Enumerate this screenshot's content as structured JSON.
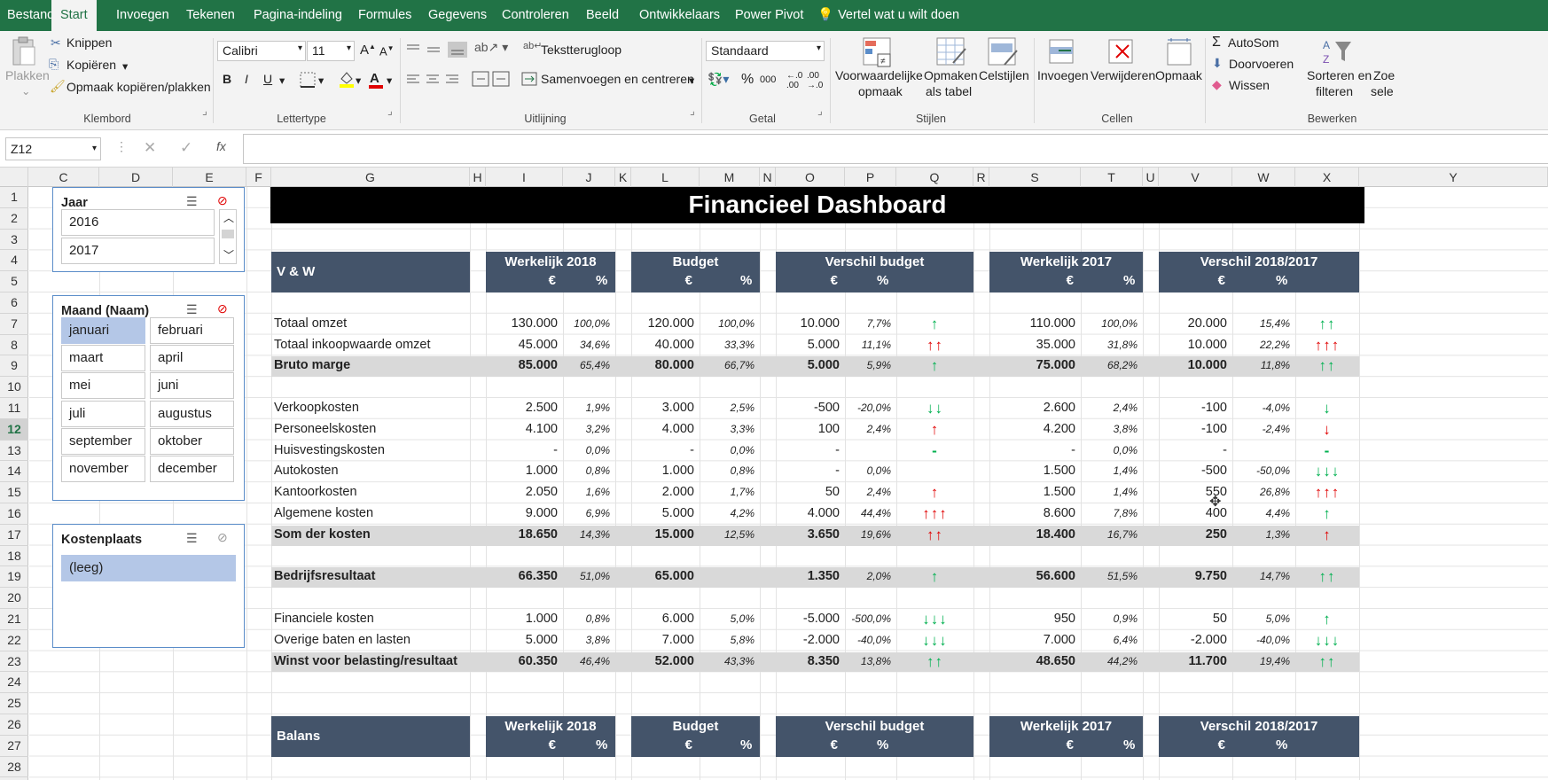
{
  "ribbon_tabs": [
    "Bestand",
    "Start",
    "Invoegen",
    "Tekenen",
    "Pagina-indeling",
    "Formules",
    "Gegevens",
    "Controleren",
    "Beeld",
    "Ontwikkelaars",
    "Power Pivot"
  ],
  "active_tab": "Start",
  "tell_me": "Vertel wat u wilt doen",
  "ribbon": {
    "paste": "Plakken",
    "cut": "Knippen",
    "copy": "Kopiëren",
    "format_painter": "Opmaak kopiëren/plakken",
    "group_clipboard": "Klembord",
    "font_name": "Calibri",
    "font_size": "11",
    "bold": "B",
    "italic": "I",
    "underline": "U",
    "group_font": "Lettertype",
    "wrap_text": "Tekstterugloop",
    "merge_center": "Samenvoegen en centreren",
    "group_alignment": "Uitlijning",
    "number_format": "Standaard",
    "percent": "%",
    "thousands": "000",
    "group_number": "Getal",
    "cond_format": "Voorwaardelijke",
    "cond_format2": "opmaak",
    "format_table": "Opmaken",
    "format_table2": "als tabel",
    "cell_styles": "Celstijlen",
    "group_styles": "Stijlen",
    "insert": "Invoegen",
    "delete": "Verwijderen",
    "format": "Opmaak",
    "group_cells": "Cellen",
    "autosum": "AutoSom",
    "fill": "Doorvoeren",
    "clear": "Wissen",
    "sort_filter": "Sorteren en",
    "sort_filter2": "filteren",
    "find": "Zoe",
    "find2": "sele",
    "group_editing": "Bewerken"
  },
  "name_box": "Z12",
  "fx": "fx",
  "columns": [
    "C",
    "D",
    "E",
    "F",
    "G",
    "H",
    "I",
    "J",
    "K",
    "L",
    "M",
    "N",
    "O",
    "P",
    "Q",
    "R",
    "S",
    "T",
    "U",
    "V",
    "W",
    "X",
    "Y"
  ],
  "rows": [
    "1",
    "2",
    "3",
    "4",
    "5",
    "6",
    "7",
    "8",
    "9",
    "10",
    "11",
    "12",
    "13",
    "14",
    "15",
    "16",
    "17",
    "18",
    "19",
    "20",
    "21",
    "22",
    "23",
    "24",
    "25",
    "26",
    "27",
    "28"
  ],
  "selected_row": "12",
  "slicers": {
    "year": {
      "title": "Jaar",
      "items": [
        "2016",
        "2017"
      ]
    },
    "month": {
      "title": "Maand (Naam)",
      "items": [
        "januari",
        "februari",
        "maart",
        "april",
        "mei",
        "juni",
        "juli",
        "augustus",
        "september",
        "oktober",
        "november",
        "december"
      ],
      "selected": "januari"
    },
    "costcenter": {
      "title": "Kostenplaats",
      "items": [
        "(leeg)"
      ]
    }
  },
  "dashboard": {
    "title": "Financieel Dashboard",
    "section1": "V & W",
    "section2": "Balans",
    "group_headers": [
      "Werkelijk 2018",
      "Budget",
      "Verschil budget",
      "Werkelijk 2017",
      "Verschil 2018/2017"
    ],
    "currency": "€",
    "percent": "%",
    "rows": [
      {
        "label": "Totaal omzet",
        "bold": false,
        "v": [
          "130.000",
          "100,0%",
          "120.000",
          "100,0%",
          "10.000",
          "7,7%",
          "↑",
          "110.000",
          "100,0%",
          "20.000",
          "15,4%",
          "↑↑"
        ],
        "a1": "up",
        "a2": "up"
      },
      {
        "label": "Totaal inkoopwaarde omzet",
        "bold": false,
        "v": [
          "45.000",
          "34,6%",
          "40.000",
          "33,3%",
          "5.000",
          "11,1%",
          "↑↑",
          "35.000",
          "31,8%",
          "10.000",
          "22,2%",
          "↑↑↑"
        ],
        "a1": "rd",
        "a2": "rd"
      },
      {
        "label": "Bruto marge",
        "bold": true,
        "v": [
          "85.000",
          "65,4%",
          "80.000",
          "66,7%",
          "5.000",
          "5,9%",
          "↑",
          "75.000",
          "68,2%",
          "10.000",
          "11,8%",
          "↑↑"
        ],
        "a1": "up",
        "a2": "up"
      },
      null,
      {
        "label": "Verkoopkosten",
        "bold": false,
        "v": [
          "2.500",
          "1,9%",
          "3.000",
          "2,5%",
          "-500",
          "-20,0%",
          "↓↓",
          "2.600",
          "2,4%",
          "-100",
          "-4,0%",
          "↓"
        ],
        "a1": "up",
        "a2": "up"
      },
      {
        "label": "Personeelskosten",
        "bold": false,
        "v": [
          "4.100",
          "3,2%",
          "4.000",
          "3,3%",
          "100",
          "2,4%",
          "↑",
          "4.200",
          "3,8%",
          "-100",
          "-2,4%",
          "↓"
        ],
        "a1": "rd",
        "a2": "rd"
      },
      {
        "label": "Huisvestingskosten",
        "bold": false,
        "v": [
          "-",
          "0,0%",
          "-",
          "0,0%",
          "-",
          "",
          "-",
          "-",
          "0,0%",
          "-",
          "",
          "-"
        ],
        "a1": "up",
        "a2": "up"
      },
      {
        "label": "Autokosten",
        "bold": false,
        "v": [
          "1.000",
          "0,8%",
          "1.000",
          "0,8%",
          "-",
          "0,0%",
          "",
          "1.500",
          "1,4%",
          "-500",
          "-50,0%",
          "↓↓↓"
        ],
        "a1": "up",
        "a2": "up"
      },
      {
        "label": "Kantoorkosten",
        "bold": false,
        "v": [
          "2.050",
          "1,6%",
          "2.000",
          "1,7%",
          "50",
          "2,4%",
          "↑",
          "1.500",
          "1,4%",
          "550",
          "26,8%",
          "↑↑↑"
        ],
        "a1": "rd",
        "a2": "rd"
      },
      {
        "label": "Algemene kosten",
        "bold": false,
        "v": [
          "9.000",
          "6,9%",
          "5.000",
          "4,2%",
          "4.000",
          "44,4%",
          "↑↑↑",
          "8.600",
          "7,8%",
          "400",
          "4,4%",
          "↑"
        ],
        "a1": "rd",
        "a2": "up"
      },
      {
        "label": "Som der kosten",
        "bold": true,
        "v": [
          "18.650",
          "14,3%",
          "15.000",
          "12,5%",
          "3.650",
          "19,6%",
          "↑↑",
          "18.400",
          "16,7%",
          "250",
          "1,3%",
          "↑"
        ],
        "a1": "rd",
        "a2": "rd"
      },
      null,
      {
        "label": "Bedrijfsresultaat",
        "bold": true,
        "v": [
          "66.350",
          "51,0%",
          "65.000",
          "",
          "1.350",
          "2,0%",
          "↑",
          "56.600",
          "51,5%",
          "9.750",
          "14,7%",
          "↑↑"
        ],
        "a1": "up",
        "a2": "up"
      },
      null,
      {
        "label": "Financiele kosten",
        "bold": false,
        "v": [
          "1.000",
          "0,8%",
          "6.000",
          "5,0%",
          "-5.000",
          "-500,0%",
          "↓↓↓",
          "950",
          "0,9%",
          "50",
          "5,0%",
          "↑"
        ],
        "a1": "up",
        "a2": "up"
      },
      {
        "label": "Overige baten en lasten",
        "bold": false,
        "v": [
          "5.000",
          "3,8%",
          "7.000",
          "5,8%",
          "-2.000",
          "-40,0%",
          "↓↓↓",
          "7.000",
          "6,4%",
          "-2.000",
          "-40,0%",
          "↓↓↓"
        ],
        "a1": "up",
        "a2": "up"
      },
      {
        "label": "Winst voor belasting/resultaat",
        "bold": true,
        "v": [
          "60.350",
          "46,4%",
          "52.000",
          "43,3%",
          "8.350",
          "13,8%",
          "↑↑",
          "48.650",
          "44,2%",
          "11.700",
          "19,4%",
          "↑↑"
        ],
        "a1": "up",
        "a2": "up"
      }
    ]
  }
}
